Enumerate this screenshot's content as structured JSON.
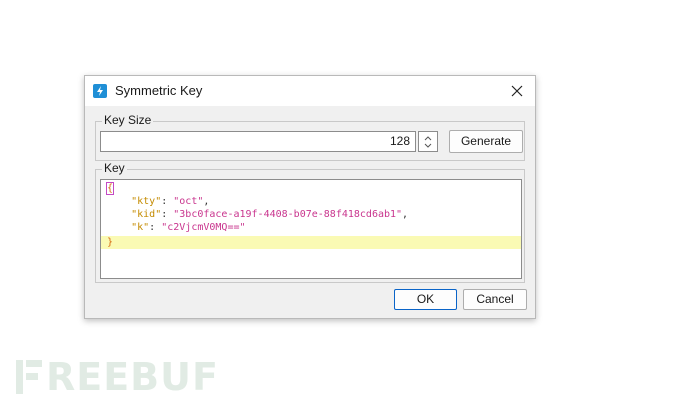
{
  "dialog": {
    "title": "Symmetric Key",
    "icon": "lightning-icon",
    "close_icon": "close-icon"
  },
  "key_size": {
    "group_label": "Key Size",
    "value": "128",
    "generate_label": "Generate"
  },
  "key": {
    "group_label": "Key",
    "open_brace": "{",
    "close_brace": "}",
    "fields": [
      {
        "key": "\"kty\"",
        "value": "\"oct\"",
        "trail": ","
      },
      {
        "key": "\"kid\"",
        "value": "\"3bc0face-a19f-4408-b07e-88f418cd6ab1\"",
        "trail": ","
      },
      {
        "key": "\"k\"",
        "value": "\"c2VjcmV0MQ==\"",
        "trail": ""
      }
    ]
  },
  "buttons": {
    "ok_label": "OK",
    "cancel_label": "Cancel"
  },
  "watermark": {
    "text": "REEBUF"
  },
  "colors": {
    "accent": "#1f8fd6",
    "json_key": "#c48b00",
    "json_value": "#c9358e",
    "brace": "#d66a0f",
    "line_highlight": "#fafab4"
  }
}
